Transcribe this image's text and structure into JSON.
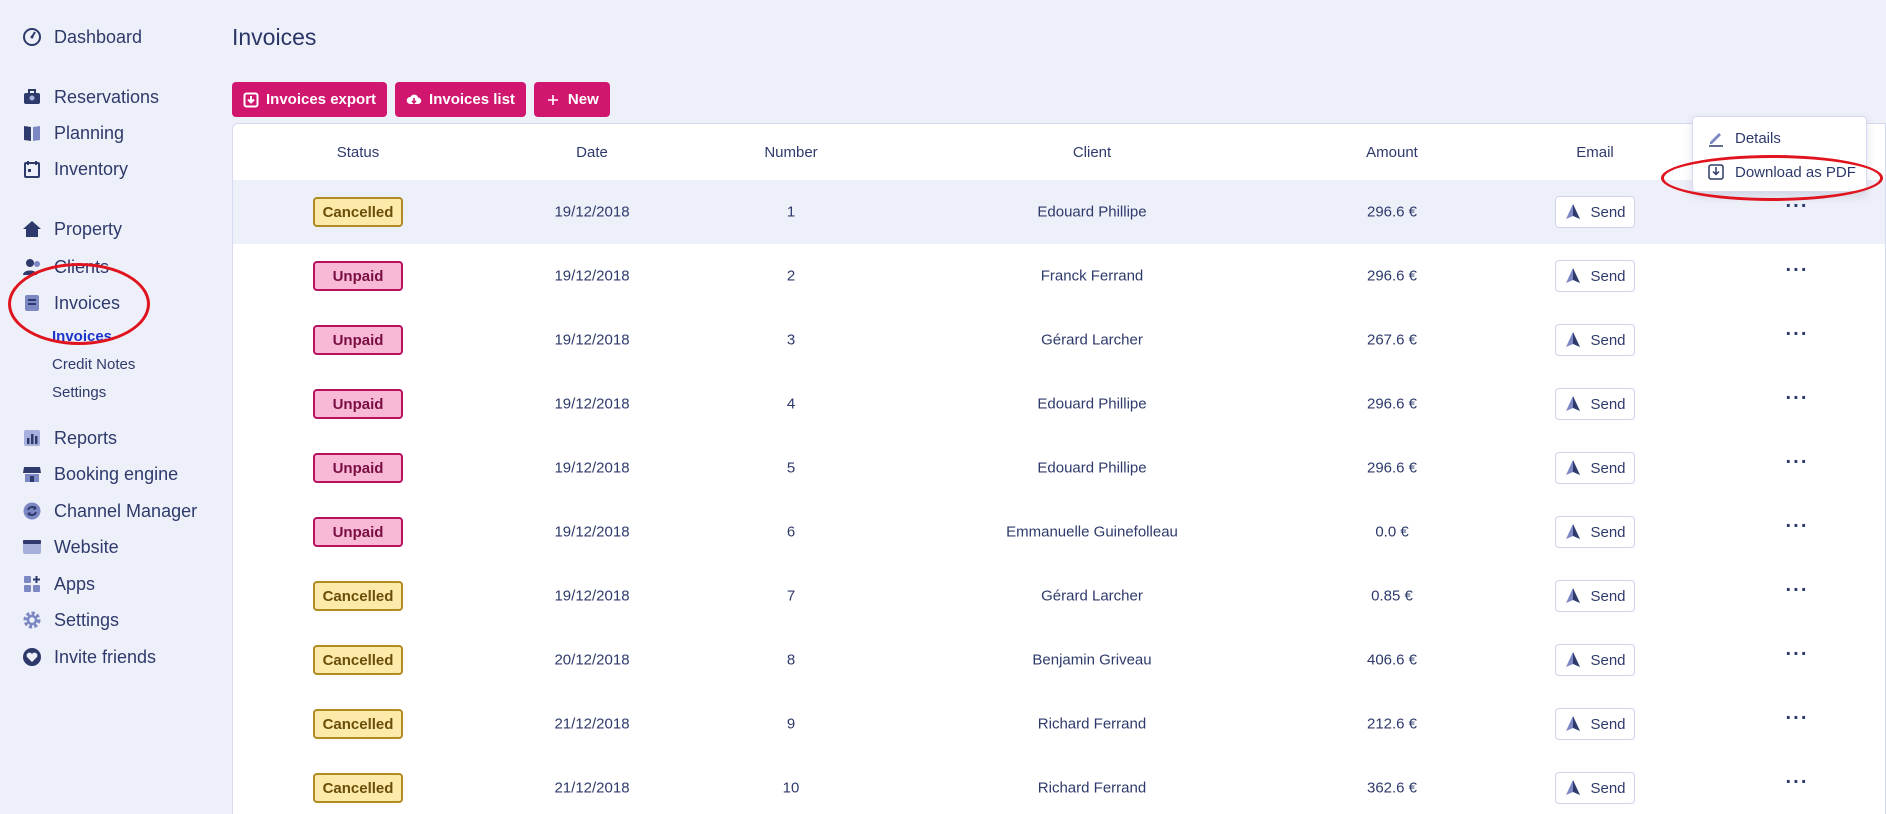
{
  "sidebar": {
    "items": [
      {
        "label": "Dashboard",
        "icon": "speedometer-icon"
      },
      {
        "label": "Reservations",
        "icon": "briefcase-icon"
      },
      {
        "label": "Planning",
        "icon": "book-icon"
      },
      {
        "label": "Inventory",
        "icon": "calendar-icon"
      },
      {
        "label": "Property",
        "icon": "home-icon"
      },
      {
        "label": "Clients",
        "icon": "users-icon"
      },
      {
        "label": "Invoices",
        "icon": "invoice-icon"
      },
      {
        "label": "Reports",
        "icon": "bar-chart-icon"
      },
      {
        "label": "Booking engine",
        "icon": "storefront-icon"
      },
      {
        "label": "Channel Manager",
        "icon": "sync-icon"
      },
      {
        "label": "Website",
        "icon": "browser-icon"
      },
      {
        "label": "Apps",
        "icon": "apps-icon"
      },
      {
        "label": "Settings",
        "icon": "gear-icon"
      },
      {
        "label": "Invite friends",
        "icon": "heart-icon"
      }
    ],
    "sub_items": [
      {
        "label": "Invoices",
        "active": true
      },
      {
        "label": "Credit Notes",
        "active": false
      },
      {
        "label": "Settings",
        "active": false
      }
    ]
  },
  "page": {
    "title": "Invoices"
  },
  "toolbar": {
    "export_label": "Invoices export",
    "list_label": "Invoices list",
    "new_label": "New"
  },
  "table": {
    "headers": [
      "Status",
      "Date",
      "Number",
      "Client",
      "Amount",
      "Email"
    ],
    "send_label": "Send",
    "more_label": "···",
    "rows": [
      {
        "status": "Cancelled",
        "date": "19/12/2018",
        "number": "1",
        "client": "Edouard Phillipe",
        "amount": "296.6 €"
      },
      {
        "status": "Unpaid",
        "date": "19/12/2018",
        "number": "2",
        "client": "Franck Ferrand",
        "amount": "296.6 €"
      },
      {
        "status": "Unpaid",
        "date": "19/12/2018",
        "number": "3",
        "client": "Gérard Larcher",
        "amount": "267.6 €"
      },
      {
        "status": "Unpaid",
        "date": "19/12/2018",
        "number": "4",
        "client": "Edouard Phillipe",
        "amount": "296.6 €"
      },
      {
        "status": "Unpaid",
        "date": "19/12/2018",
        "number": "5",
        "client": "Edouard Phillipe",
        "amount": "296.6 €"
      },
      {
        "status": "Unpaid",
        "date": "19/12/2018",
        "number": "6",
        "client": "Emmanuelle Guinefolleau",
        "amount": "0.0 €"
      },
      {
        "status": "Cancelled",
        "date": "19/12/2018",
        "number": "7",
        "client": "Gérard Larcher",
        "amount": "0.85 €"
      },
      {
        "status": "Cancelled",
        "date": "20/12/2018",
        "number": "8",
        "client": "Benjamin Griveau",
        "amount": "406.6 €"
      },
      {
        "status": "Cancelled",
        "date": "21/12/2018",
        "number": "9",
        "client": "Richard Ferrand",
        "amount": "212.6 €"
      },
      {
        "status": "Cancelled",
        "date": "21/12/2018",
        "number": "10",
        "client": "Richard Ferrand",
        "amount": "362.6 €"
      }
    ]
  },
  "dropdown": {
    "details_label": "Details",
    "download_label": "Download as PDF"
  },
  "colors": {
    "accent": "#d1166f",
    "active_link": "#1c34c9",
    "annotation": "#e0141e",
    "cancelled_bg": "#fde9a9",
    "unpaid_bg": "#f7b9d6"
  }
}
